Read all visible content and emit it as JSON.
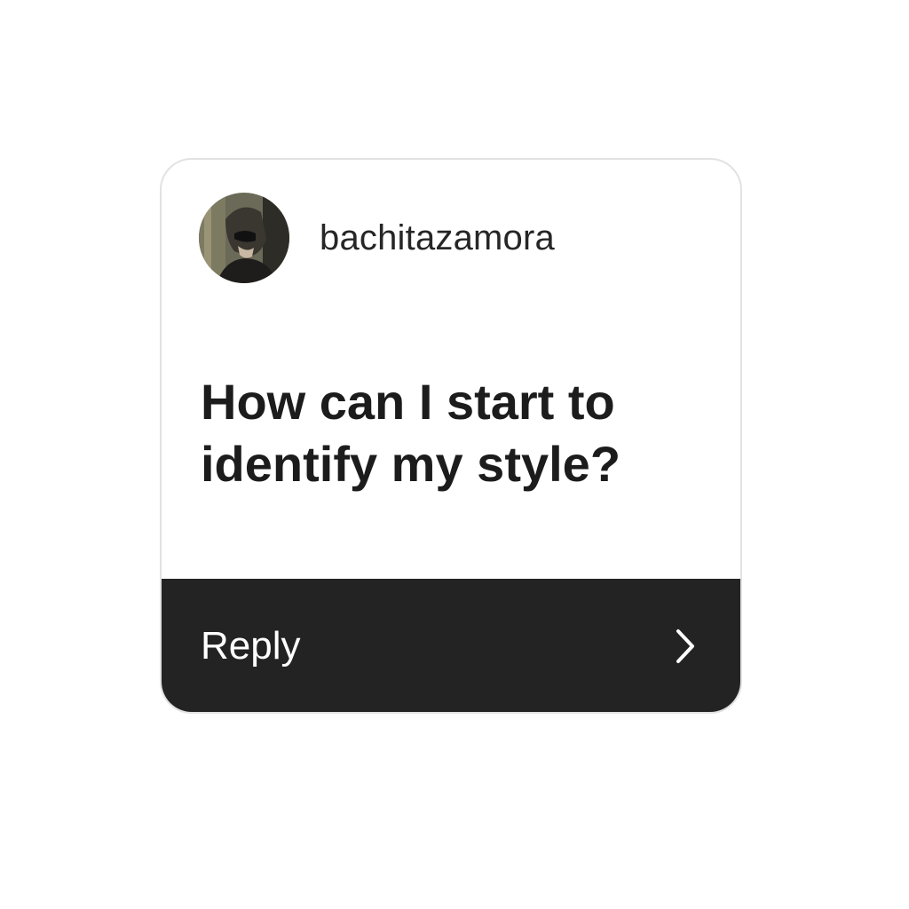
{
  "question_card": {
    "username": "bachitazamora",
    "question": "How can I start to identify my style?",
    "reply_label": "Reply",
    "icons": {
      "avatar": "profile-avatar",
      "chevron": "chevron-right-icon"
    },
    "colors": {
      "card_background": "#ffffff",
      "reply_bar_background": "#232323",
      "question_text": "#1c1c1c"
    }
  }
}
